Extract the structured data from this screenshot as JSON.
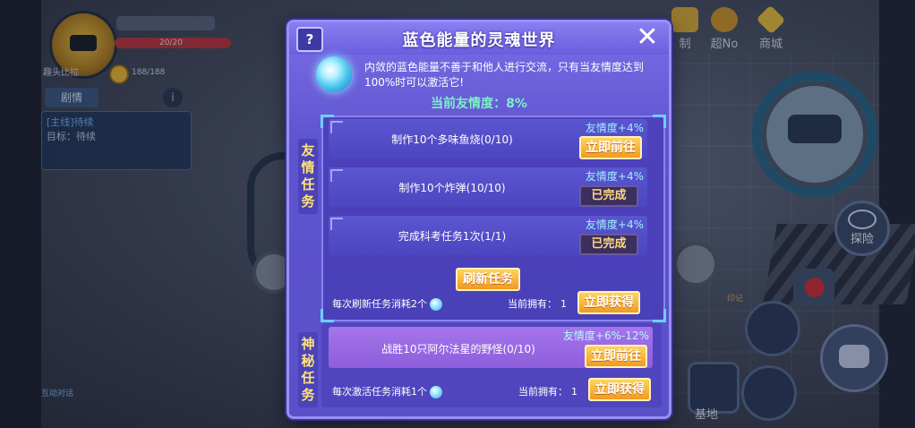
{
  "hud": {
    "hp_text": "20/20",
    "player_name": "趣头比拉",
    "energy_text": "188/188",
    "drama_tab": "剧情",
    "info_icon": "i",
    "quest_line1": "[主线]待续",
    "quest_line2": "目标：待续",
    "bottom_hint": "互动对话",
    "top_icons": [
      {
        "label": "制",
        "icon": "badge-icon",
        "color": "#e2b33a"
      },
      {
        "label": "超No",
        "icon": "face-icon",
        "color": "#d79b2c"
      },
      {
        "label": "商城",
        "icon": "diamond-icon",
        "color": "#f2c63e"
      }
    ],
    "explore_label": "探险",
    "base_label": "基地",
    "mini_label": "印记"
  },
  "dialog": {
    "help_label": "?",
    "title": "蓝色能量的灵魂世界",
    "close_label": "✕",
    "description": "内敛的蓝色能量不善于和他人进行交流，只有当友情度达到100%时可以激活它!",
    "rate_label": "当前友情度：",
    "rate_value": "8%",
    "friend_section": {
      "side_label": "友情任务",
      "tasks": [
        {
          "name": "制作10个多味鱼烧(0/10)",
          "bonus": "友情度+4%",
          "action": "立即前往",
          "completed": false
        },
        {
          "name": "制作10个炸弹(10/10)",
          "bonus": "友情度+4%",
          "action": "已完成",
          "completed": true
        },
        {
          "name": "完成科考任务1次(1/1)",
          "bonus": "友情度+4%",
          "action": "已完成",
          "completed": true
        }
      ],
      "refresh_label": "刷新任务",
      "cost_text": "每次刷新任务消耗2个",
      "own_label": "当前拥有：",
      "own_value": "1",
      "get_label": "立即获得"
    },
    "secret_section": {
      "side_label": "神秘任务",
      "task": {
        "name": "战胜10只阿尔法星的野怪(0/10)",
        "bonus": "友情度+6%-12%",
        "action": "立即前往"
      },
      "cost_text": "每次激活任务消耗1个",
      "own_label": "当前拥有：",
      "own_value": "1",
      "get_label": "立即获得"
    }
  },
  "colors": {
    "dialog_bg": "#5f54d0",
    "accent_orange": "#f19a22",
    "rate_green": "#7cf0c8",
    "bonus_cyan": "#9ff0ff",
    "side_label_yellow": "#ffe27a"
  }
}
